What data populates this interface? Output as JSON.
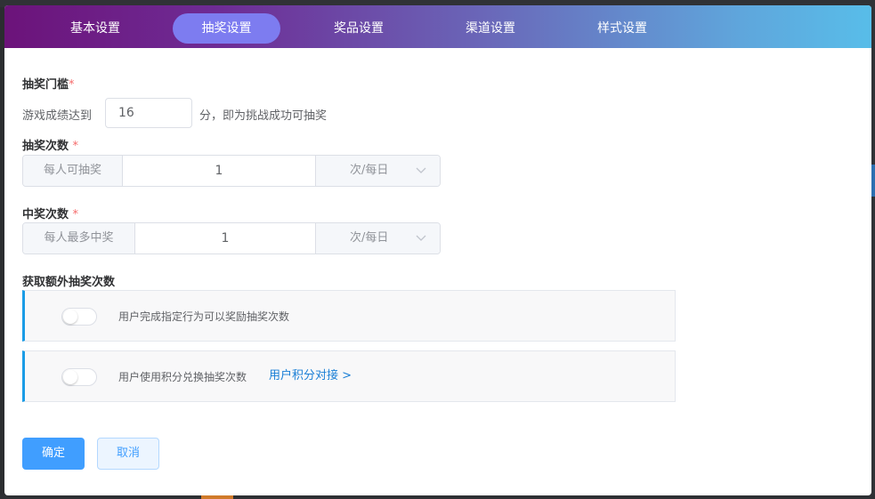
{
  "tabs": [
    {
      "label": "基本设置",
      "active": false
    },
    {
      "label": "抽奖设置",
      "active": true
    },
    {
      "label": "奖品设置",
      "active": false
    },
    {
      "label": "渠道设置",
      "active": false
    },
    {
      "label": "样式设置",
      "active": false
    }
  ],
  "threshold": {
    "label": "抽奖门槛",
    "required_mark": "*",
    "prefix": "游戏成绩达到",
    "value": "16",
    "suffix": "分，即为挑战成功可抽奖"
  },
  "draw_count": {
    "label": "抽奖次数",
    "required_mark": "*",
    "prepend": "每人可抽奖",
    "value": "1",
    "unit": "次/每日"
  },
  "win_count": {
    "label": "中奖次数",
    "required_mark": "*",
    "prepend": "每人最多中奖",
    "value": "1",
    "unit": "次/每日"
  },
  "extra": {
    "label": "获取额外抽奖次数",
    "options": [
      {
        "desc": "用户完成指定行为可以奖励抽奖次数",
        "enabled": false
      },
      {
        "desc": "用户使用积分兑换抽奖次数",
        "enabled": false,
        "link": "用户积分对接 >"
      }
    ]
  },
  "buttons": {
    "confirm": "确定",
    "cancel": "取消"
  },
  "colors": {
    "accent": "#409eff",
    "active_tab": "#7d7cf0",
    "required": "#f56c6c",
    "card_border": "#1a9ce6"
  }
}
